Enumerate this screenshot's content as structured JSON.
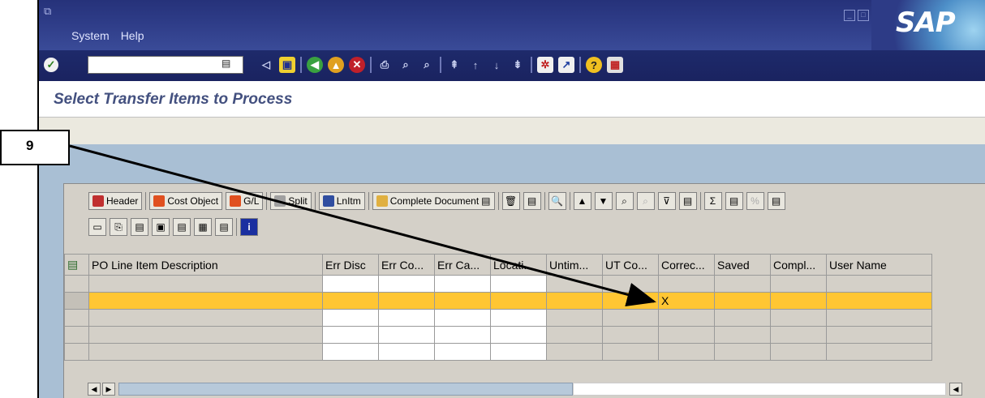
{
  "menu": {
    "system": "System",
    "help": "Help"
  },
  "logo_text": "SAP",
  "command_field": {
    "value": ""
  },
  "screen_title": "Select Transfer Items to Process",
  "callout_number": "9",
  "alv_toolbar": {
    "row1": [
      "Header",
      "Cost Object",
      "G/L",
      "Split",
      "LnItm",
      "Complete Document"
    ]
  },
  "grid": {
    "columns": [
      "PO Line Item Description",
      "Err Disc",
      "Err Co...",
      "Err Ca...",
      "Locati...",
      "Untim...",
      "UT Co...",
      "Correc...",
      "Saved",
      "Compl...",
      "User Name"
    ],
    "rows": [
      [
        "",
        "",
        "",
        "",
        "",
        "",
        "",
        "",
        "",
        "",
        ""
      ],
      [
        "",
        "",
        "",
        "",
        "",
        "",
        "",
        "X",
        "",
        "",
        ""
      ],
      [
        "",
        "",
        "",
        "",
        "",
        "",
        "",
        "",
        "",
        "",
        ""
      ],
      [
        "",
        "",
        "",
        "",
        "",
        "",
        "",
        "",
        "",
        "",
        ""
      ],
      [
        "",
        "",
        "",
        "",
        "",
        "",
        "",
        "",
        "",
        "",
        ""
      ]
    ],
    "highlighted_row": 1
  },
  "colors": {
    "highlight": "#ffc633",
    "title": "#43507f"
  }
}
